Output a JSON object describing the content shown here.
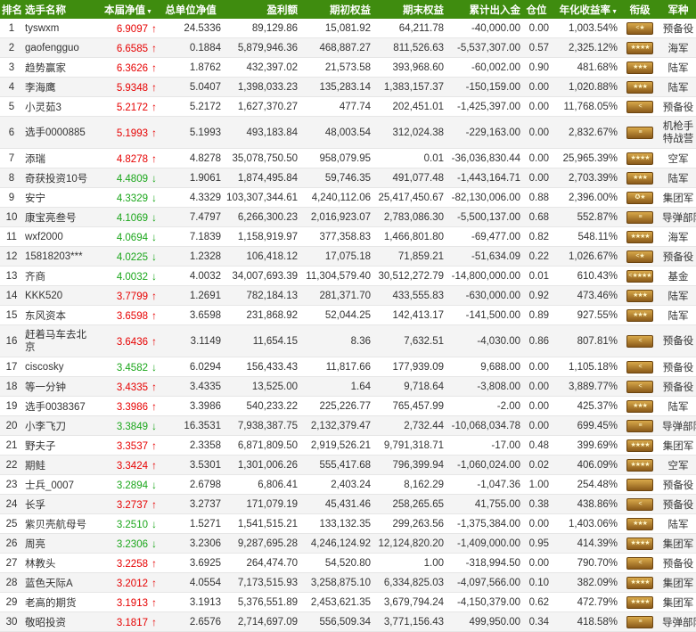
{
  "headers": {
    "rank": "排名",
    "name": "选手名称",
    "nav": "本届净值",
    "total_nav": "总单位净值",
    "profit": "盈利额",
    "initial": "期初权益",
    "final": "期末权益",
    "flow": "累计出入金",
    "position": "仓位",
    "annual": "年化收益率",
    "military": "衔级",
    "army": "军种",
    "sort_mark": "▼"
  },
  "colors": {
    "header_bg": "#3f8c0f",
    "up": "#e60000",
    "down": "#1aa61a"
  },
  "rows": [
    {
      "rank": "1",
      "name": "tyswxm",
      "nav": "6.9097",
      "dir": "up",
      "total": "24.5336",
      "profit": "89,129.86",
      "initial": "15,081.92",
      "final": "64,211.78",
      "flow": "-40,000.00",
      "pos": "0.00",
      "annual": "1,003.54%",
      "badge": "< ★",
      "army": "预备役"
    },
    {
      "rank": "2",
      "name": "gaofengguo",
      "nav": "6.6585",
      "dir": "up",
      "total": "0.1884",
      "profit": "5,879,946.36",
      "initial": "468,887.27",
      "final": "811,526.63",
      "flow": "-5,537,307.00",
      "pos": "0.57",
      "annual": "2,325.12%",
      "badge": "★★★★",
      "army": "海军"
    },
    {
      "rank": "3",
      "name": "趋势赢家",
      "nav": "6.3626",
      "dir": "up",
      "total": "1.8762",
      "profit": "432,397.02",
      "initial": "21,573.58",
      "final": "393,968.60",
      "flow": "-60,002.00",
      "pos": "0.90",
      "annual": "481.68%",
      "badge": "★★★",
      "army": "陆军"
    },
    {
      "rank": "4",
      "name": "李海鹰",
      "nav": "5.9348",
      "dir": "up",
      "total": "5.0407",
      "profit": "1,398,033.23",
      "initial": "135,283.14",
      "final": "1,383,157.37",
      "flow": "-150,159.00",
      "pos": "0.00",
      "annual": "1,020.88%",
      "badge": "★★★",
      "army": "陆军"
    },
    {
      "rank": "5",
      "name": "小灵茹3",
      "nav": "5.2172",
      "dir": "up",
      "total": "5.2172",
      "profit": "1,627,370.27",
      "initial": "477.74",
      "final": "202,451.01",
      "flow": "-1,425,397.00",
      "pos": "0.00",
      "annual": "11,768.05%",
      "badge": "<",
      "army": "预备役"
    },
    {
      "rank": "6",
      "name": "选手0000885",
      "nav": "5.1993",
      "dir": "up",
      "total": "5.1993",
      "profit": "493,183.84",
      "initial": "48,003.54",
      "final": "312,024.38",
      "flow": "-229,163.00",
      "pos": "0.00",
      "annual": "2,832.67%",
      "badge": "≡",
      "army": "机枪手特战营",
      "tall": true
    },
    {
      "rank": "7",
      "name": "添瑞",
      "nav": "4.8278",
      "dir": "up",
      "total": "4.8278",
      "profit": "35,078,750.50",
      "initial": "958,079.95",
      "final": "0.01",
      "flow": "-36,036,830.44",
      "pos": "0.00",
      "annual": "25,965.39%",
      "badge": "★★★★",
      "army": "空军"
    },
    {
      "rank": "8",
      "name": "奇获投资10号",
      "nav": "4.4809",
      "dir": "down",
      "total": "1.9061",
      "profit": "1,874,495.84",
      "initial": "59,746.35",
      "final": "491,077.48",
      "flow": "-1,443,164.71",
      "pos": "0.00",
      "annual": "2,703.39%",
      "badge": "★★★",
      "army": "陆军"
    },
    {
      "rank": "9",
      "name": "安宁",
      "nav": "4.3329",
      "dir": "down",
      "total": "4.3329",
      "profit": "103,307,344.61",
      "initial": "4,240,112.06",
      "final": "25,417,450.67",
      "flow": "-82,130,006.00",
      "pos": "0.88",
      "annual": "2,396.00%",
      "badge": "✪ ★",
      "army": "集团军"
    },
    {
      "rank": "10",
      "name": "康宝亮叁号",
      "nav": "4.1069",
      "dir": "down",
      "total": "7.4797",
      "profit": "6,266,300.23",
      "initial": "2,016,923.07",
      "final": "2,783,086.30",
      "flow": "-5,500,137.00",
      "pos": "0.68",
      "annual": "552.87%",
      "badge": "≡",
      "army": "导弹部队"
    },
    {
      "rank": "11",
      "name": "wxf2000",
      "nav": "4.0694",
      "dir": "down",
      "total": "7.1839",
      "profit": "1,158,919.97",
      "initial": "377,358.83",
      "final": "1,466,801.80",
      "flow": "-69,477.00",
      "pos": "0.82",
      "annual": "548.11%",
      "badge": "★★★★",
      "army": "海军"
    },
    {
      "rank": "12",
      "name": "15818203***",
      "nav": "4.0225",
      "dir": "down",
      "total": "1.2328",
      "profit": "106,418.12",
      "initial": "17,075.18",
      "final": "71,859.21",
      "flow": "-51,634.09",
      "pos": "0.22",
      "annual": "1,026.67%",
      "badge": "< ★",
      "army": "预备役"
    },
    {
      "rank": "13",
      "name": "齐商",
      "nav": "4.0032",
      "dir": "down",
      "total": "4.0032",
      "profit": "34,007,693.39",
      "initial": "11,304,579.40",
      "final": "30,512,272.79",
      "flow": "-14,800,000.00",
      "pos": "0.01",
      "annual": "610.43%",
      "badge": "< ★★★★",
      "army": "基金"
    },
    {
      "rank": "14",
      "name": "KKK520",
      "nav": "3.7799",
      "dir": "up",
      "total": "1.2691",
      "profit": "782,184.13",
      "initial": "281,371.70",
      "final": "433,555.83",
      "flow": "-630,000.00",
      "pos": "0.92",
      "annual": "473.46%",
      "badge": "★★★",
      "army": "陆军"
    },
    {
      "rank": "15",
      "name": "东风资本",
      "nav": "3.6598",
      "dir": "up",
      "total": "3.6598",
      "profit": "231,868.92",
      "initial": "52,044.25",
      "final": "142,413.17",
      "flow": "-141,500.00",
      "pos": "0.89",
      "annual": "927.55%",
      "badge": "★★★",
      "army": "陆军"
    },
    {
      "rank": "16",
      "name": "赶着马车去北京",
      "nav": "3.6436",
      "dir": "up",
      "total": "3.1149",
      "profit": "11,654.15",
      "initial": "8.36",
      "final": "7,632.51",
      "flow": "-4,030.00",
      "pos": "0.86",
      "annual": "807.81%",
      "badge": "<",
      "army": "预备役",
      "tall": true
    },
    {
      "rank": "17",
      "name": "ciscosky",
      "nav": "3.4582",
      "dir": "down",
      "total": "6.0294",
      "profit": "156,433.43",
      "initial": "11,817.66",
      "final": "177,939.09",
      "flow": "9,688.00",
      "pos": "0.00",
      "annual": "1,105.18%",
      "badge": "<",
      "army": "预备役"
    },
    {
      "rank": "18",
      "name": "等一分钟",
      "nav": "3.4335",
      "dir": "up",
      "total": "3.4335",
      "profit": "13,525.00",
      "initial": "1.64",
      "final": "9,718.64",
      "flow": "-3,808.00",
      "pos": "0.00",
      "annual": "3,889.77%",
      "badge": "<",
      "army": "预备役"
    },
    {
      "rank": "19",
      "name": "选手0038367",
      "nav": "3.3986",
      "dir": "up",
      "total": "3.3986",
      "profit": "540,233.22",
      "initial": "225,226.77",
      "final": "765,457.99",
      "flow": "-2.00",
      "pos": "0.00",
      "annual": "425.37%",
      "badge": "★★★",
      "army": "陆军"
    },
    {
      "rank": "20",
      "name": "小李飞刀",
      "nav": "3.3849",
      "dir": "down",
      "total": "16.3531",
      "profit": "7,938,387.75",
      "initial": "2,132,379.47",
      "final": "2,732.44",
      "flow": "-10,068,034.78",
      "pos": "0.00",
      "annual": "699.45%",
      "badge": "≡",
      "army": "导弹部队"
    },
    {
      "rank": "21",
      "name": "野夫子",
      "nav": "3.3537",
      "dir": "up",
      "total": "2.3358",
      "profit": "6,871,809.50",
      "initial": "2,919,526.21",
      "final": "9,791,318.71",
      "flow": "-17.00",
      "pos": "0.48",
      "annual": "399.69%",
      "badge": "★★★★",
      "army": "集团军"
    },
    {
      "rank": "22",
      "name": "期鲑",
      "nav": "3.3424",
      "dir": "up",
      "total": "3.5301",
      "profit": "1,301,006.26",
      "initial": "555,417.68",
      "final": "796,399.94",
      "flow": "-1,060,024.00",
      "pos": "0.02",
      "annual": "406.09%",
      "badge": "★★★★",
      "army": "空军"
    },
    {
      "rank": "23",
      "name": "士兵_0007",
      "nav": "3.2894",
      "dir": "down",
      "total": "2.6798",
      "profit": "6,806.41",
      "initial": "2,403.24",
      "final": "8,162.29",
      "flow": "-1,047.36",
      "pos": "1.00",
      "annual": "254.48%",
      "badge": "",
      "army": "预备役"
    },
    {
      "rank": "24",
      "name": "长孚",
      "nav": "3.2737",
      "dir": "up",
      "total": "3.2737",
      "profit": "171,079.19",
      "initial": "45,431.46",
      "final": "258,265.65",
      "flow": "41,755.00",
      "pos": "0.38",
      "annual": "438.86%",
      "badge": "<",
      "army": "预备役"
    },
    {
      "rank": "25",
      "name": "紫贝壳航母号",
      "nav": "3.2510",
      "dir": "down",
      "total": "1.5271",
      "profit": "1,541,515.21",
      "initial": "133,132.35",
      "final": "299,263.56",
      "flow": "-1,375,384.00",
      "pos": "0.00",
      "annual": "1,403.06%",
      "badge": "★★★",
      "army": "陆军"
    },
    {
      "rank": "26",
      "name": "周亮",
      "nav": "3.2306",
      "dir": "down",
      "total": "3.2306",
      "profit": "9,287,695.28",
      "initial": "4,246,124.92",
      "final": "12,124,820.20",
      "flow": "-1,409,000.00",
      "pos": "0.95",
      "annual": "414.39%",
      "badge": "★★★★",
      "army": "集团军"
    },
    {
      "rank": "27",
      "name": "林教头",
      "nav": "3.2258",
      "dir": "up",
      "total": "3.6925",
      "profit": "264,474.70",
      "initial": "54,520.80",
      "final": "1.00",
      "flow": "-318,994.50",
      "pos": "0.00",
      "annual": "790.70%",
      "badge": "<",
      "army": "预备役"
    },
    {
      "rank": "28",
      "name": "蓝色天际A",
      "nav": "3.2012",
      "dir": "up",
      "total": "4.0554",
      "profit": "7,173,515.93",
      "initial": "3,258,875.10",
      "final": "6,334,825.03",
      "flow": "-4,097,566.00",
      "pos": "0.10",
      "annual": "382.09%",
      "badge": "★★★★",
      "army": "集团军"
    },
    {
      "rank": "29",
      "name": "老高的期货",
      "nav": "3.1913",
      "dir": "up",
      "total": "3.1913",
      "profit": "5,376,551.89",
      "initial": "2,453,621.35",
      "final": "3,679,794.24",
      "flow": "-4,150,379.00",
      "pos": "0.62",
      "annual": "472.79%",
      "badge": "★★★★",
      "army": "集团军"
    },
    {
      "rank": "30",
      "name": "敬昭投资",
      "nav": "3.1817",
      "dir": "up",
      "total": "2.6576",
      "profit": "2,714,697.09",
      "initial": "556,509.34",
      "final": "3,771,156.43",
      "flow": "499,950.00",
      "pos": "0.34",
      "annual": "418.58%",
      "badge": "≡",
      "army": "导弹部队"
    }
  ]
}
